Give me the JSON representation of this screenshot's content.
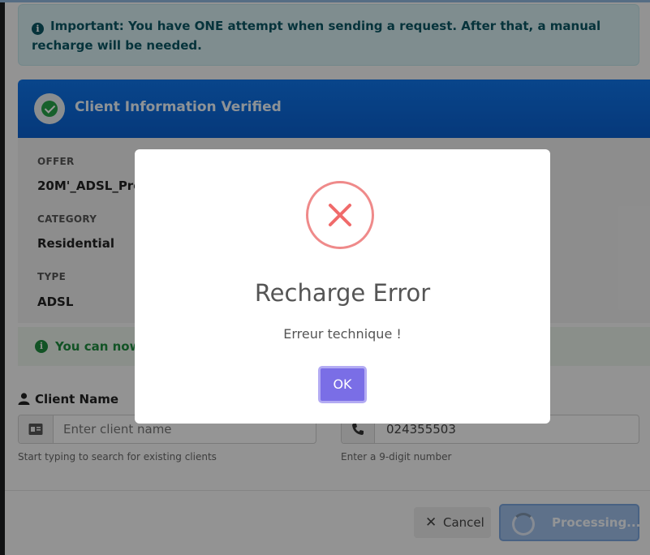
{
  "alert": {
    "text": "Important: You have ONE attempt when sending a request. After that, a manual recharge will be needed."
  },
  "card": {
    "title": "Client Information Verified"
  },
  "fields": [
    {
      "label": "OFFER",
      "value": "20M'_ADSL_Pre"
    },
    {
      "label": "CATEGORY",
      "value": "Residential"
    },
    {
      "label": "TYPE",
      "value": "ADSL"
    }
  ],
  "success": {
    "text": "You can now"
  },
  "client_name": {
    "label": "Client Name",
    "placeholder": "Enter client name",
    "hint": "Start typing to search for existing clients"
  },
  "phone": {
    "value": "024355503",
    "hint": "Enter a 9-digit number"
  },
  "footer": {
    "cancel_label": "Cancel",
    "processing_label": "Processing..."
  },
  "modal": {
    "title": "Recharge Error",
    "message": "Erreur technique !",
    "ok_label": "OK"
  }
}
